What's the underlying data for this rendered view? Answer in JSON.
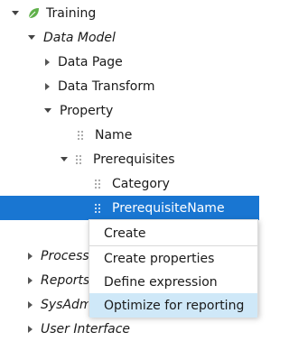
{
  "tree": {
    "training": "Training",
    "data_model": "Data Model",
    "data_page": "Data Page",
    "data_transform": "Data Transform",
    "property": "Property",
    "name": "Name",
    "prerequisites": "Prerequisites",
    "category": "Category",
    "prerequisite_name": "PrerequisiteName",
    "process": "Process",
    "reports": "Reports",
    "sysadmin": "SysAdmin",
    "user_interface": "User Interface"
  },
  "context_menu": {
    "create": "Create",
    "create_properties": "Create properties",
    "define_expression": "Define expression",
    "optimize_for_reporting": "Optimize for reporting"
  },
  "colors": {
    "selected_row": "#1976d2",
    "menu_highlight": "#cfe8f8",
    "leaf_icon": "#5fb04a"
  }
}
